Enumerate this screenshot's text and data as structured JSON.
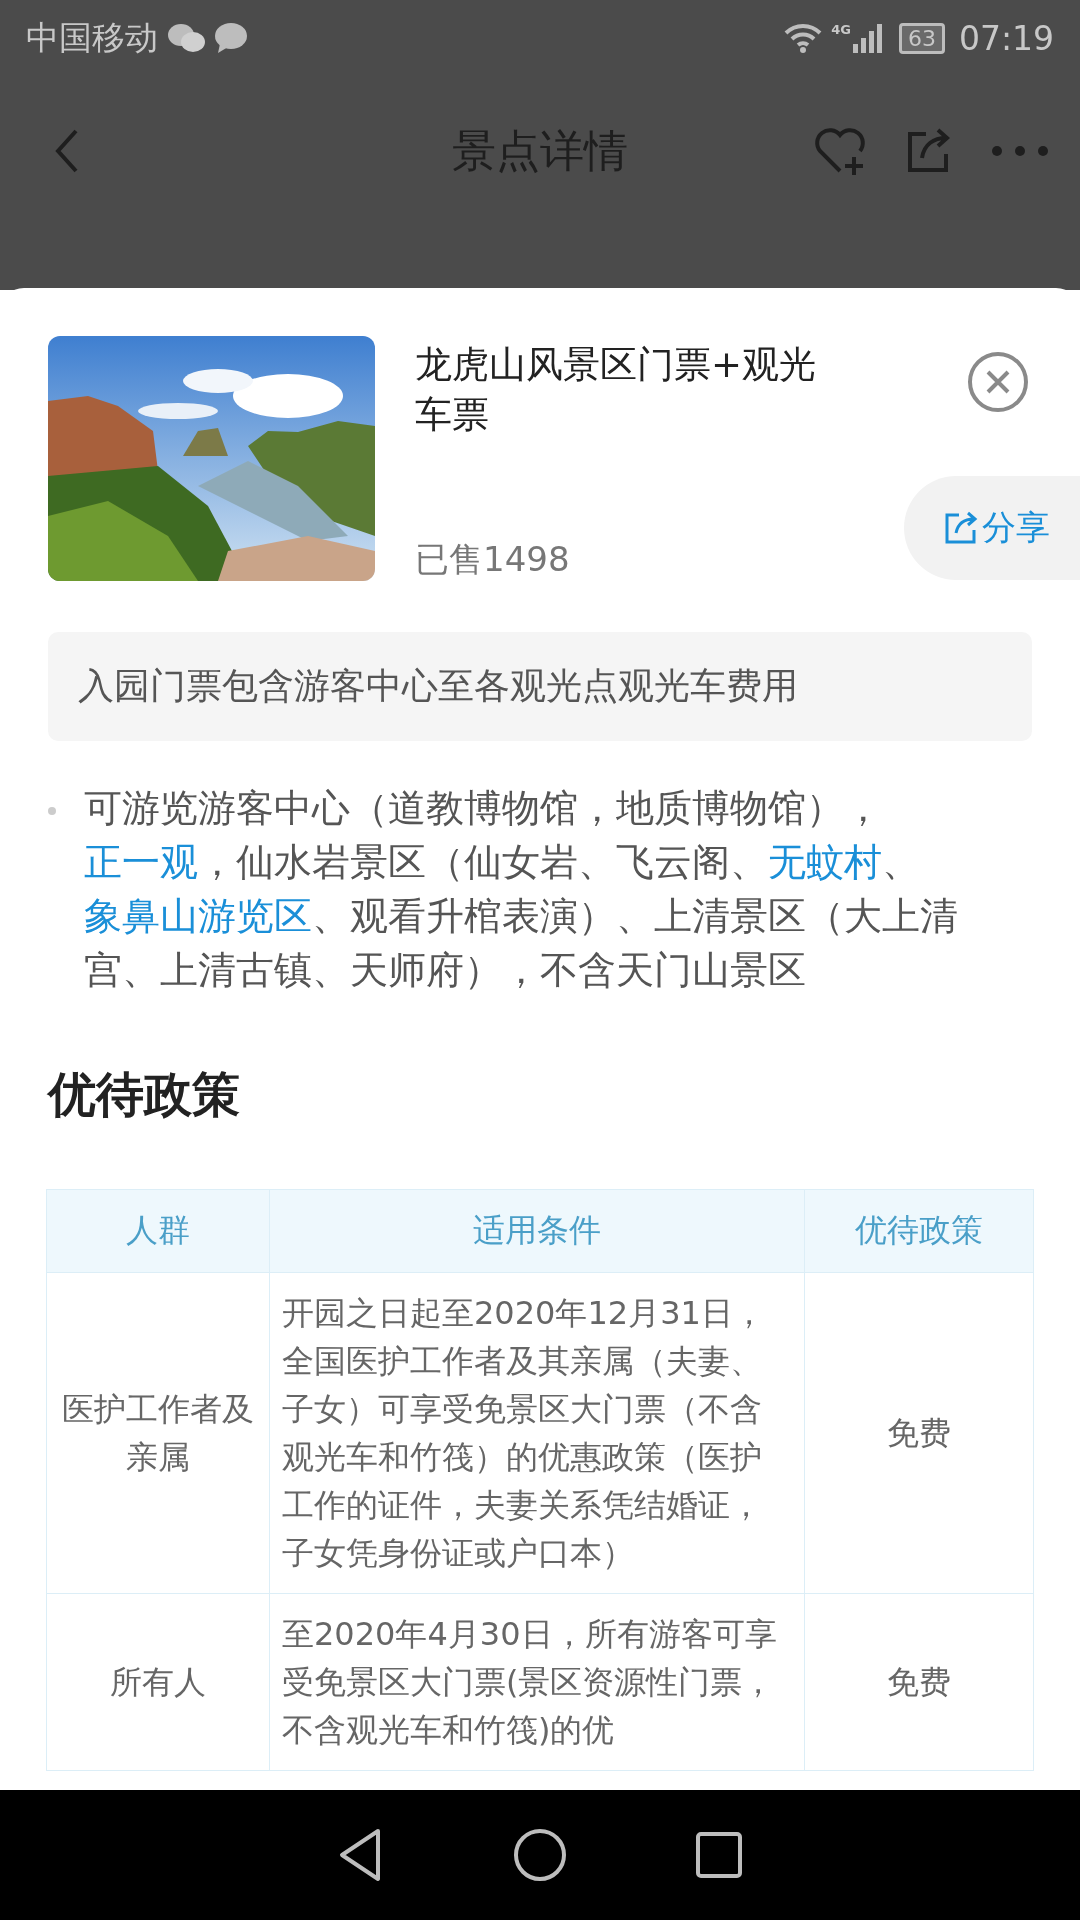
{
  "status_bar": {
    "carrier": "中国移动",
    "network": "4G",
    "battery": "63",
    "time": "07:19"
  },
  "header": {
    "title": "景点详情"
  },
  "product": {
    "title": "龙虎山风景区门票+观光车票",
    "sold": "已售1498",
    "share": "分享"
  },
  "notice": "入园门票包含游客中心至各观光点观光车费用",
  "description": [
    {
      "text": "可游览游客中心（道教博物馆，地质博物馆），",
      "link": false
    },
    {
      "text": "正一观",
      "link": true
    },
    {
      "text": "，仙水岩景区（仙女岩、飞云阁、",
      "link": false
    },
    {
      "text": "无蚊村",
      "link": true
    },
    {
      "text": "、",
      "link": false
    },
    {
      "text": "象鼻山游览区",
      "link": true
    },
    {
      "text": "、观看升棺表演）、上清景区（大上清宫、上清古镇、天师府），不含天门山景区",
      "link": false
    }
  ],
  "policy": {
    "heading": "优待政策",
    "columns": [
      "人群",
      "适用条件",
      "优待政策"
    ],
    "rows": [
      {
        "group": "医护工作者及亲属",
        "conditions": "开园之日起至2020年12月31日，全国医护工作者及其亲属（夫妻、子女）可享受免景区大门票（不含观光车和竹筏）的优惠政策（医护工作的证件，夫妻关系凭结婚证，子女凭身份证或户口本）",
        "policy": "免费"
      },
      {
        "group": "所有人",
        "conditions": "至2020年4月30日，所有游客可享受免景区大门票(景区资源性门票，不含观光车和竹筏)的优",
        "policy": "免费"
      }
    ]
  }
}
